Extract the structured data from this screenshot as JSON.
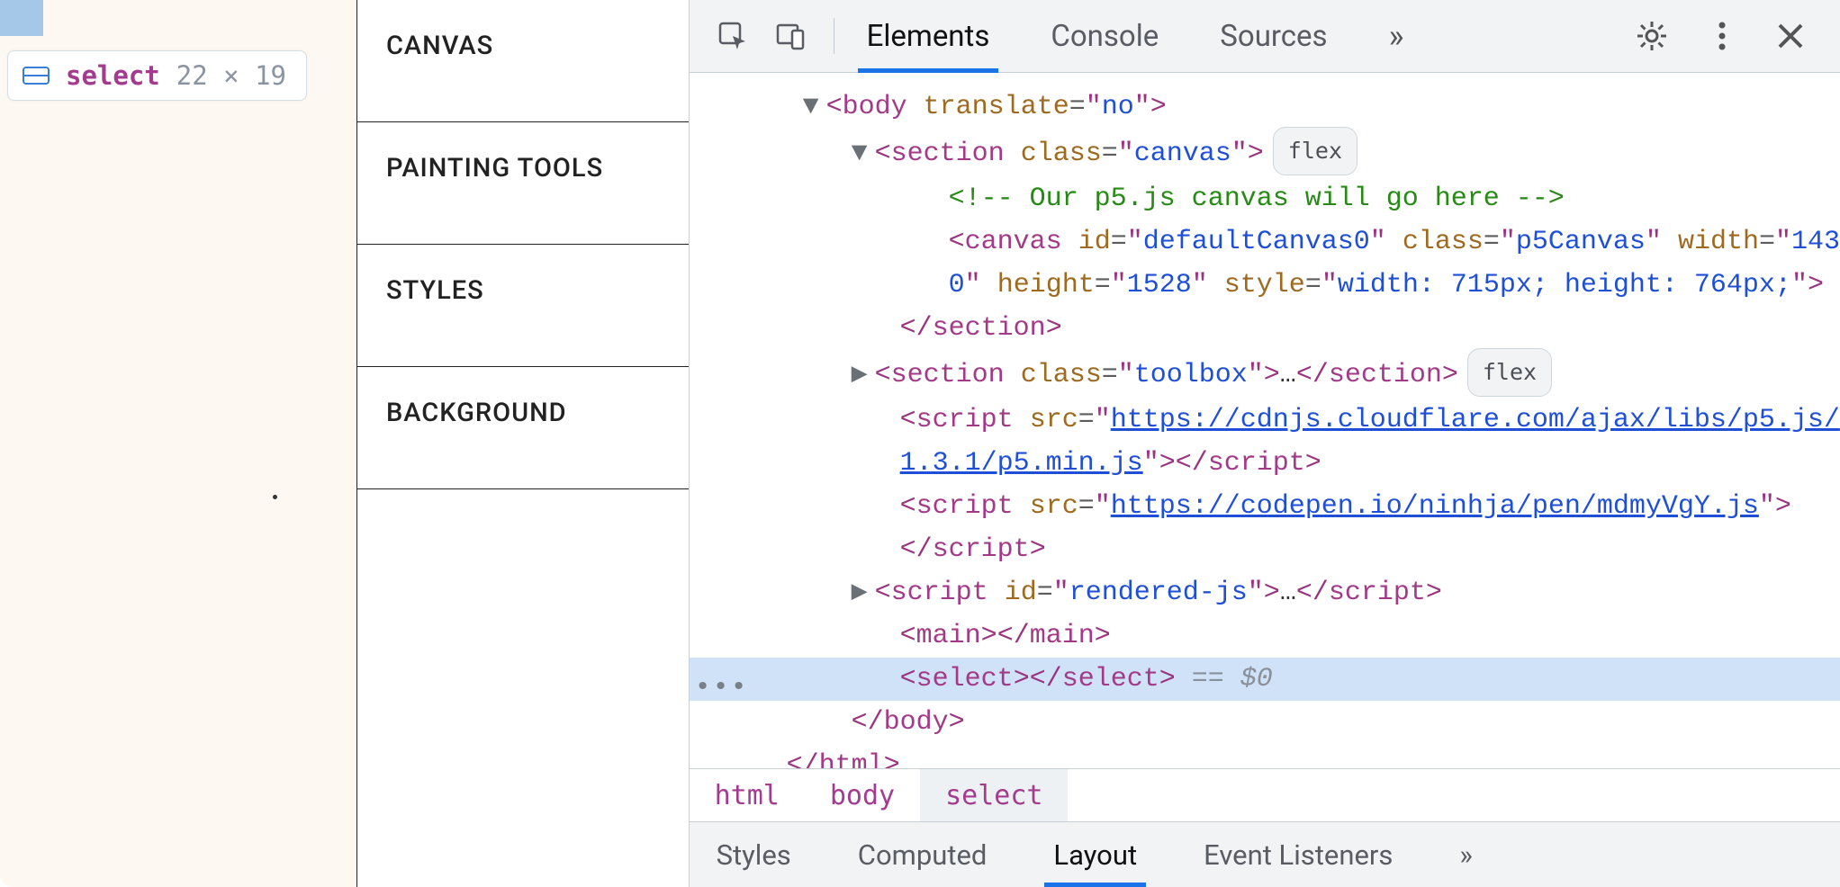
{
  "tooltip": {
    "tag": "select",
    "dims": "22 × 19"
  },
  "toolbox": [
    "CANVAS",
    "PAINTING TOOLS",
    "STYLES",
    "BACKGROUND"
  ],
  "devtools": {
    "tabs": [
      "Elements",
      "Console",
      "Sources"
    ],
    "breadcrumb": [
      "html",
      "body",
      "select"
    ],
    "subtabs": [
      "Styles",
      "Computed",
      "Layout",
      "Event Listeners"
    ],
    "badges": {
      "flex": "flex"
    }
  },
  "dom": {
    "body_tag": "body",
    "body_attr": "translate",
    "body_val": "no",
    "sec_tag": "section",
    "class_attr": "class",
    "canvas_class": "canvas",
    "comment": "<!-- Our p5.js canvas will go here -->",
    "canvas_tag": "canvas",
    "id_attr": "id",
    "id_val": "defaultCanvas0",
    "p5class": "p5Canvas",
    "width_attr": "width",
    "width_val": "143",
    "zero": "0",
    "height_attr": "height",
    "height_val": "1528",
    "style_attr": "style",
    "style_val": "width: 715px; height: 764px;",
    "section_close": "section",
    "toolbox_class": "toolbox",
    "script_tag": "script",
    "src_attr": "src",
    "src1a": "https://cdnjs.cloudflare.com/ajax/libs/p5.js/",
    "src1b": "1.3.1/p5.min.js",
    "src2": "https://codepen.io/ninhja/pen/mdmyVgY.js",
    "rendered_id": "rendered-js",
    "main_tag": "main",
    "select_tag": "select",
    "eqref": " == $0",
    "html_close": "html"
  }
}
